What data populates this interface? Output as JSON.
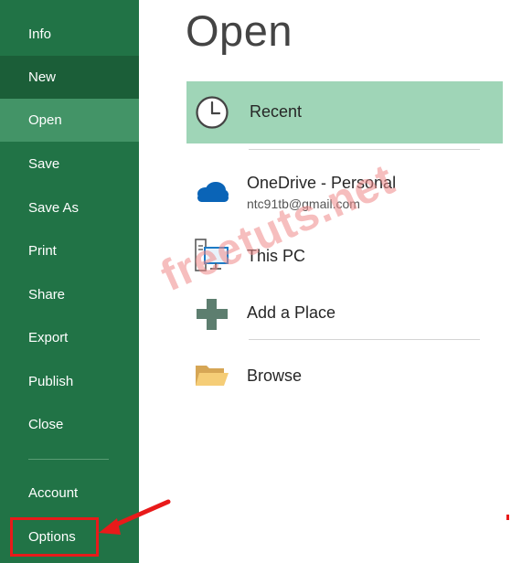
{
  "nav": {
    "items": [
      {
        "label": "Info"
      },
      {
        "label": "New"
      },
      {
        "label": "Open"
      },
      {
        "label": "Save"
      },
      {
        "label": "Save As"
      },
      {
        "label": "Print"
      },
      {
        "label": "Share"
      },
      {
        "label": "Export"
      },
      {
        "label": "Publish"
      },
      {
        "label": "Close"
      },
      {
        "label": "Account"
      },
      {
        "label": "Options"
      }
    ],
    "selected": "Open"
  },
  "main": {
    "title": "Open",
    "recent": {
      "label": "Recent",
      "icon": "clock-icon"
    },
    "locations": [
      {
        "label": "OneDrive - Personal",
        "sub": "ntc91tb@gmail.com",
        "icon": "onedrive-cloud-icon"
      },
      {
        "label": "This PC",
        "icon": "computer-icon"
      },
      {
        "label": "Add a Place",
        "icon": "add-place-icon"
      },
      {
        "label": "Browse",
        "icon": "folder-icon"
      }
    ]
  },
  "watermark": "freetuts.net",
  "colors": {
    "nav_bg": "#217346",
    "nav_selected": "#439467",
    "nav_new": "#1b5e38",
    "recent_highlight": "#9fd5b7",
    "annotation_red": "#e81a1a"
  }
}
